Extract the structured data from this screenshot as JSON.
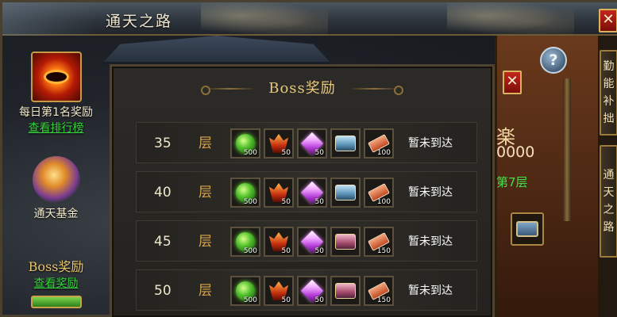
{
  "window": {
    "title": "通天之路",
    "close_label": "✕"
  },
  "left_panel": {
    "daily_reward_label": "每日第1名奖励",
    "view_ranking_link": "查看排行榜",
    "fund_label": "通天基金",
    "boss_reward_title": "Boss奖励",
    "view_rewards_link": "查看奖励"
  },
  "right_panel": {
    "help_label": "?",
    "close_label": "✕",
    "peek_char": "楽",
    "peek_score": "0000",
    "peek_floor": "第7层",
    "tabs": [
      "勤能补拙",
      "通天之路"
    ]
  },
  "popup": {
    "title": "Boss奖励",
    "rows": [
      {
        "floor": "35",
        "unit": "层",
        "status": "暂未到达",
        "items": [
          {
            "icon": "green-orb-icon",
            "qty": "500"
          },
          {
            "icon": "flame-icon",
            "qty": "50"
          },
          {
            "icon": "purple-gem-icon",
            "qty": "50"
          },
          {
            "icon": "blue-chest-icon",
            "qty": ""
          },
          {
            "icon": "red-book-icon",
            "qty": "100"
          }
        ]
      },
      {
        "floor": "40",
        "unit": "层",
        "status": "暂未到达",
        "items": [
          {
            "icon": "green-orb-icon",
            "qty": "500"
          },
          {
            "icon": "flame-icon",
            "qty": "50"
          },
          {
            "icon": "purple-gem-icon",
            "qty": "50"
          },
          {
            "icon": "blue-chest-icon",
            "qty": ""
          },
          {
            "icon": "red-book-icon",
            "qty": "100"
          }
        ]
      },
      {
        "floor": "45",
        "unit": "层",
        "status": "暂未到达",
        "items": [
          {
            "icon": "green-orb-icon",
            "qty": "500"
          },
          {
            "icon": "flame-icon",
            "qty": "50"
          },
          {
            "icon": "purple-gem-icon",
            "qty": "50"
          },
          {
            "icon": "red-chest-icon",
            "qty": ""
          },
          {
            "icon": "red-book-icon",
            "qty": "150"
          }
        ]
      },
      {
        "floor": "50",
        "unit": "层",
        "status": "暂未到达",
        "items": [
          {
            "icon": "green-orb-icon",
            "qty": "500"
          },
          {
            "icon": "flame-icon",
            "qty": "50"
          },
          {
            "icon": "purple-gem-icon",
            "qty": "50"
          },
          {
            "icon": "red-chest-icon",
            "qty": ""
          },
          {
            "icon": "red-book-icon",
            "qty": "150"
          }
        ]
      }
    ]
  }
}
